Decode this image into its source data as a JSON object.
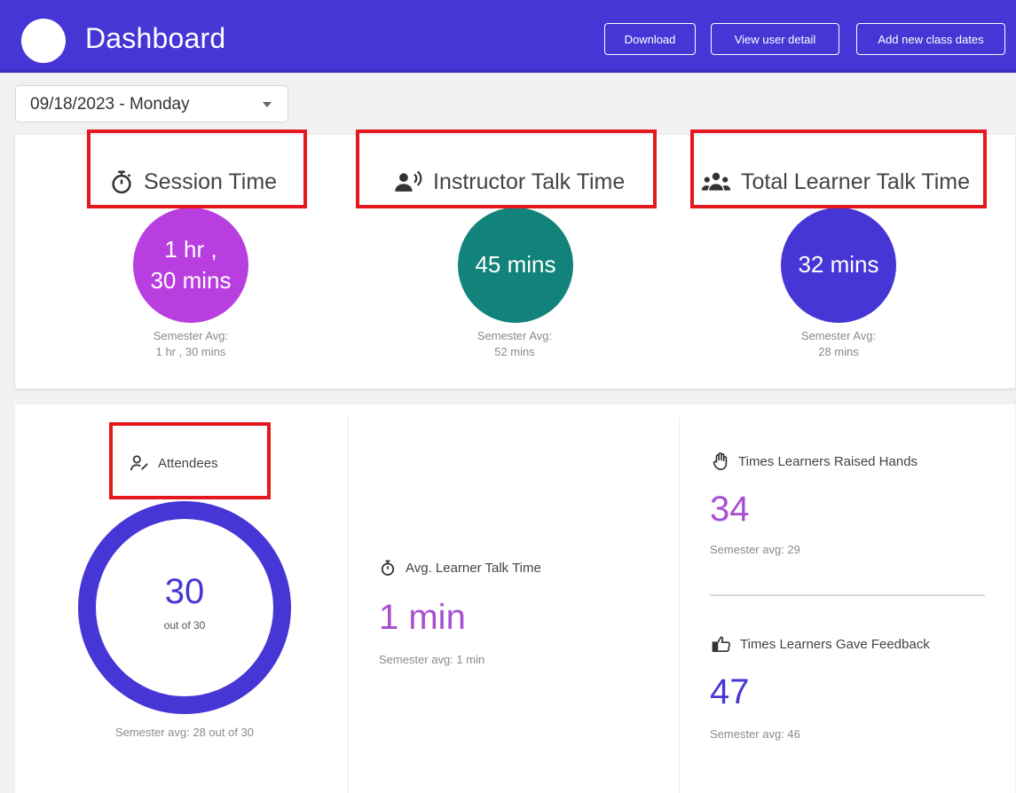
{
  "header": {
    "title": "Dashboard",
    "buttons": {
      "download": "Download",
      "view_user_detail": "View user detail",
      "add_class_dates": "Add new class dates"
    }
  },
  "date_select": {
    "value": "09/18/2023 - Monday"
  },
  "metrics": {
    "session": {
      "title": "Session Time",
      "value_line1": "1 hr ,",
      "value_line2": "30 mins",
      "avg_label": "Semester Avg:",
      "avg_value": "1 hr , 30 mins",
      "color": "#b93ee0"
    },
    "instructor": {
      "title": "Instructor Talk Time",
      "value": "45 mins",
      "avg_label": "Semester Avg:",
      "avg_value": "52 mins",
      "color": "#12837a"
    },
    "learner": {
      "title": "Total Learner Talk Time",
      "value": "32 mins",
      "avg_label": "Semester Avg:",
      "avg_value": "28 mins",
      "color": "#4636d6"
    }
  },
  "attendees": {
    "title": "Attendees",
    "count": "30",
    "out_of": "out of 30",
    "semester_avg": "Semester avg: 28 out of 30",
    "ring_color": "#4636d6"
  },
  "avg_learner_talk": {
    "title": "Avg. Learner Talk Time",
    "value": "1 min",
    "semester_avg": "Semester avg: 1 min"
  },
  "raised_hands": {
    "title": "Times Learners Raised Hands",
    "value": "34",
    "semester_avg": "Semester avg: 29",
    "color": "#a84ed1"
  },
  "feedback": {
    "title": "Times Learners Gave Feedback",
    "value": "47",
    "semester_avg": "Semester avg: 46",
    "color": "#4636d6"
  },
  "icons": [
    "stopwatch-icon",
    "speaking-person-icon",
    "group-icon",
    "person-icon",
    "raised-hand-icon",
    "thumbs-up-icon"
  ],
  "colors": {
    "header": "#4636d6",
    "highlight": "#e4181e"
  }
}
